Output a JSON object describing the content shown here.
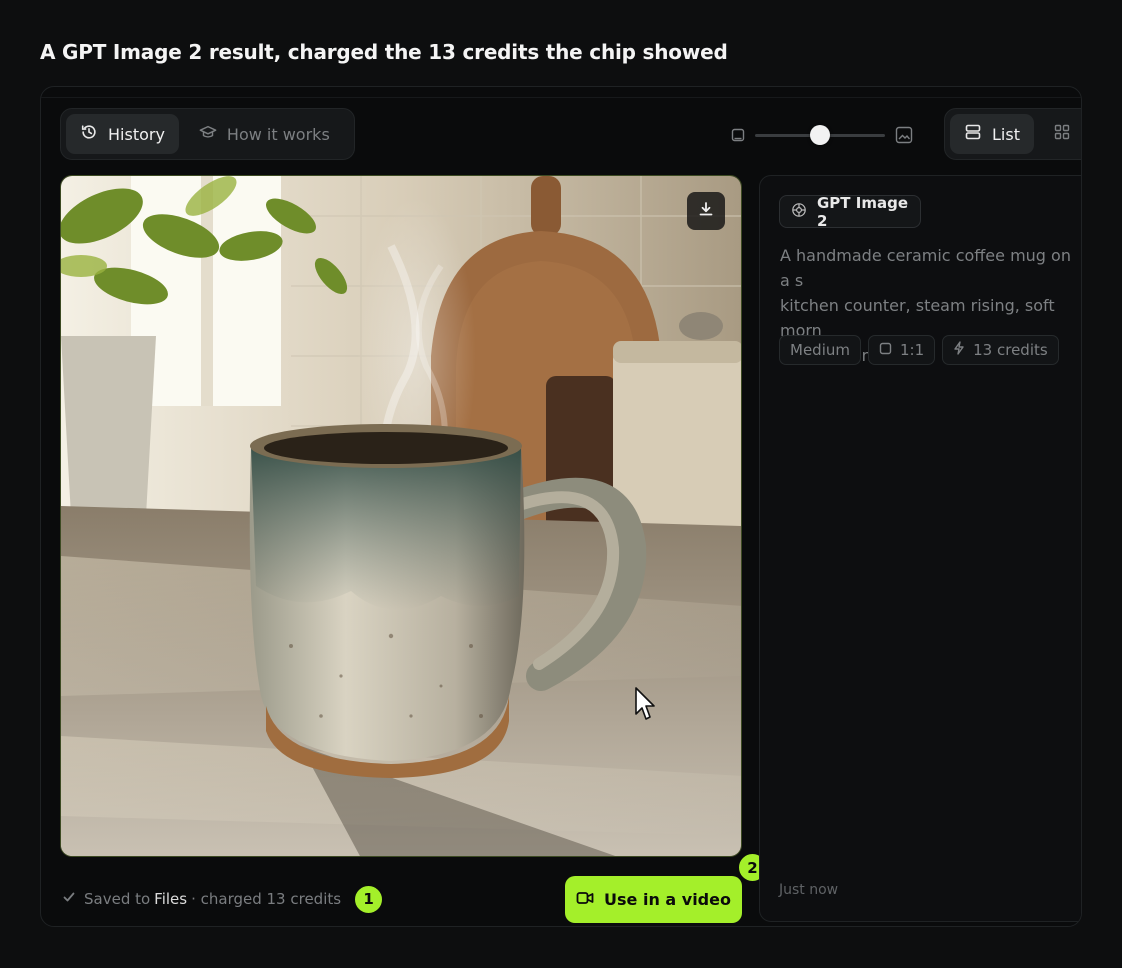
{
  "page": {
    "heading": "A GPT Image 2 result, charged the 13 credits the chip showed"
  },
  "toolbar": {
    "tabs": [
      {
        "label": "History",
        "icon": "history-icon",
        "active": true
      },
      {
        "label": "How it works",
        "icon": "graduation-cap-icon",
        "active": false
      }
    ],
    "size_slider": {
      "value": 0.5
    },
    "views": [
      {
        "label": "List",
        "icon": "list-icon",
        "active": true
      },
      {
        "label": "",
        "icon": "grid-icon",
        "active": false
      }
    ]
  },
  "result": {
    "image_subject": "steaming handmade ceramic coffee mug on a kitchen counter",
    "download_icon": "download-icon"
  },
  "footer": {
    "saved_prefix": "Saved to",
    "saved_location": "Files",
    "charged_text": "· charged 13 credits",
    "badge_1": "1",
    "badge_2": "2",
    "use_video_label": "Use in a video"
  },
  "details": {
    "model": "GPT Image 2",
    "prompt": "A handmade ceramic coffee mug on a s\nkitchen counter, steam rising, soft morn\nlight, 50mm",
    "tags": [
      {
        "label": "Medium",
        "icon": ""
      },
      {
        "label": "1:1",
        "icon": "square-icon"
      },
      {
        "label": "13 credits",
        "icon": "lightning-icon"
      }
    ],
    "timestamp": "Just now"
  },
  "colors": {
    "accent": "#a4ef2a",
    "background": "#0d0e0f"
  }
}
